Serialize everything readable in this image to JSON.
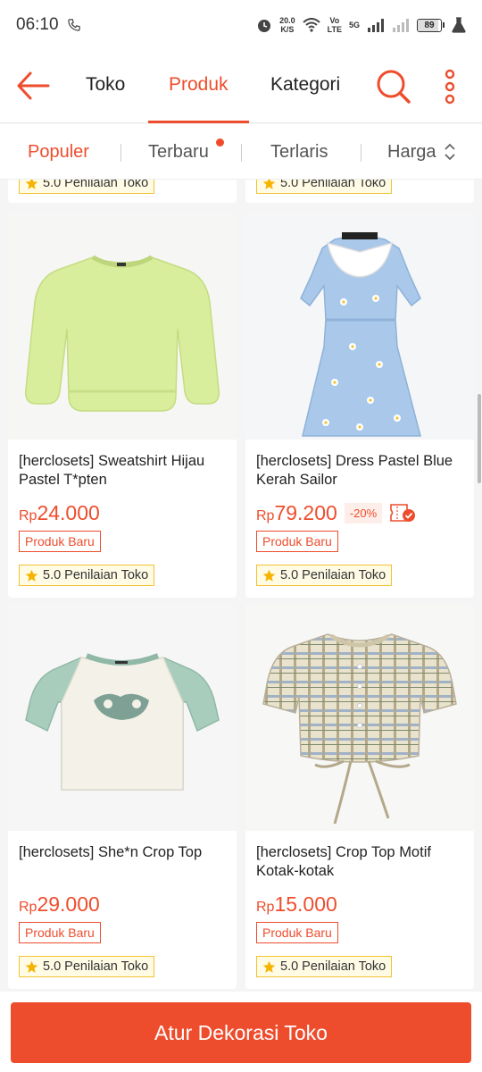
{
  "status_bar": {
    "time": "06:10",
    "net_speed_top": "20.0",
    "net_speed_bottom": "K/S",
    "volte_top": "Vo",
    "volte_bottom": "LTE",
    "network": "5G",
    "battery": "89",
    "battery_level": 0.89
  },
  "nav": {
    "tabs": [
      "Toko",
      "Produk",
      "Kategori"
    ],
    "active_tab": "Produk",
    "accent_color": "#ee4d2d"
  },
  "sort": {
    "items": [
      "Populer",
      "Terbaru",
      "Terlaris",
      "Harga"
    ],
    "active": "Populer"
  },
  "rating_label": "5.0 Penilaian Toko",
  "products": [
    {
      "title": "[herclosets] Sweatshirt Hijau Pastel T*pten",
      "currency": "Rp",
      "price": "24.000",
      "discount": "",
      "badge": "Produk Baru",
      "rating": "5.0 Penilaian Toko",
      "image_icon": "sweatshirt-image"
    },
    {
      "title": "[herclosets] Dress Pastel Blue Kerah Sailor",
      "currency": "Rp",
      "price": "79.200",
      "discount": "-20%",
      "badge": "Produk Baru",
      "rating": "5.0 Penilaian Toko",
      "image_icon": "dress-image"
    },
    {
      "title": "[herclosets] She*n Crop Top",
      "currency": "Rp",
      "price": "29.000",
      "discount": "",
      "badge": "Produk Baru",
      "rating": "5.0 Penilaian Toko",
      "image_icon": "crop-top-image"
    },
    {
      "title": "[herclosets]  Crop Top Motif Kotak-kotak",
      "currency": "Rp",
      "price": "15.000",
      "discount": "",
      "badge": "Produk Baru",
      "rating": "5.0 Penilaian Toko",
      "image_icon": "plaid-top-image"
    }
  ],
  "bottom_button": "Atur Dekorasi Toko"
}
